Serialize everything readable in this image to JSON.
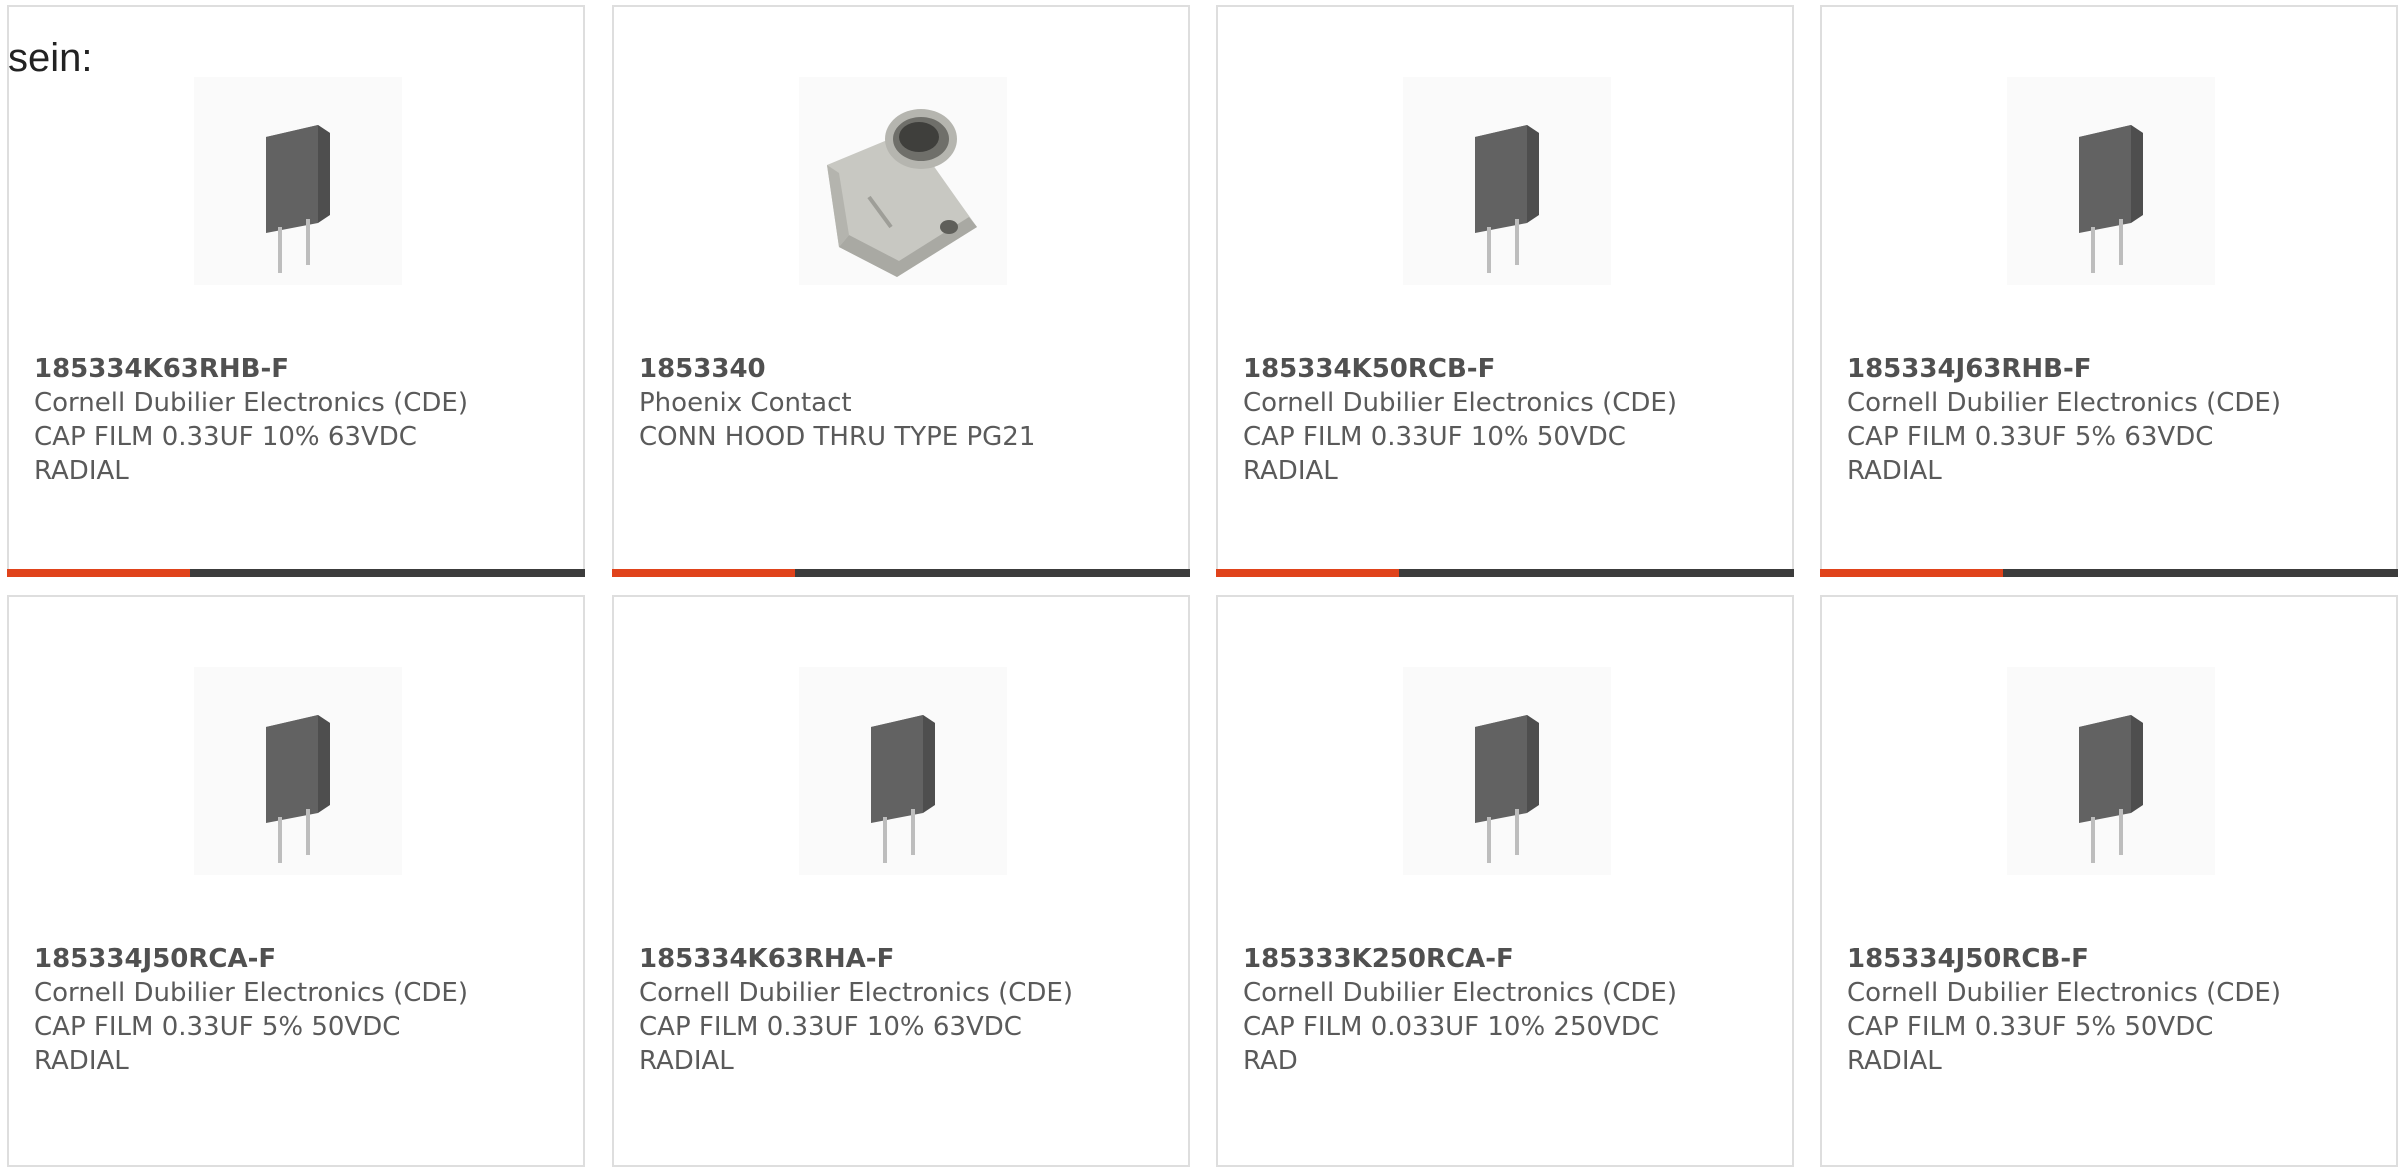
{
  "intro_text": "sein:",
  "products": [
    {
      "part_number": "185334K63RHB-F",
      "manufacturer": "Cornell Dubilier Electronics (CDE)",
      "description": "CAP FILM 0.33UF 10% 63VDC RADIAL",
      "image_icon": "film-capacitor-icon"
    },
    {
      "part_number": "1853340",
      "manufacturer": "Phoenix Contact",
      "description": "CONN HOOD THRU TYPE PG21",
      "image_icon": "connector-hood-icon"
    },
    {
      "part_number": "185334K50RCB-F",
      "manufacturer": "Cornell Dubilier Electronics (CDE)",
      "description": "CAP FILM 0.33UF 10% 50VDC RADIAL",
      "image_icon": "film-capacitor-icon"
    },
    {
      "part_number": "185334J63RHB-F",
      "manufacturer": "Cornell Dubilier Electronics (CDE)",
      "description": "CAP FILM 0.33UF 5% 63VDC RADIAL",
      "image_icon": "film-capacitor-icon"
    },
    {
      "part_number": "185334J50RCA-F",
      "manufacturer": "Cornell Dubilier Electronics (CDE)",
      "description": "CAP FILM 0.33UF 5% 50VDC RADIAL",
      "image_icon": "film-capacitor-icon"
    },
    {
      "part_number": "185334K63RHA-F",
      "manufacturer": "Cornell Dubilier Electronics (CDE)",
      "description": "CAP FILM 0.33UF 10% 63VDC RADIAL",
      "image_icon": "film-capacitor-icon"
    },
    {
      "part_number": "185333K250RCA-F",
      "manufacturer": "Cornell Dubilier Electronics (CDE)",
      "description": "CAP FILM 0.033UF 10% 250VDC RAD",
      "image_icon": "film-capacitor-icon"
    },
    {
      "part_number": "185334J50RCB-F",
      "manufacturer": "Cornell Dubilier Electronics (CDE)",
      "description": "CAP FILM 0.33UF 5% 50VDC RADIAL",
      "image_icon": "film-capacitor-icon"
    }
  ],
  "colors": {
    "accent": "#e0431b",
    "bar": "#3c3c3c",
    "card_border": "#dedede"
  }
}
